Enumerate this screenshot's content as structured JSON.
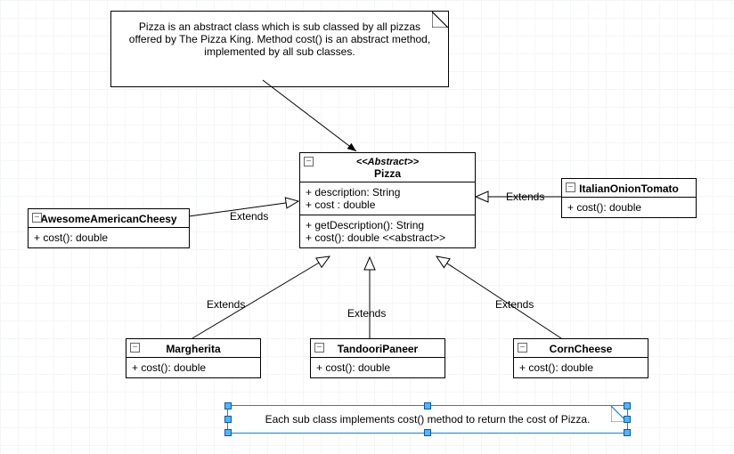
{
  "notes": {
    "top": {
      "text": "Pizza is an abstract class which is sub classed by all pizzas offered by The Pizza King. Method cost() is an abstract method, implemented by all sub classes."
    },
    "bottom": {
      "text": "Each sub class implements cost() method to return the cost of Pizza."
    }
  },
  "classes": {
    "pizza": {
      "stereotype": "<<Abstract>>",
      "name": "Pizza",
      "attrs": [
        "+ description: String",
        "+ cost : double"
      ],
      "ops": [
        "+ getDescription(): String",
        "+ cost(): double <<abstract>>"
      ]
    },
    "awesome": {
      "name": "AwesomeAmericanCheesy",
      "ops": [
        "+ cost(): double"
      ]
    },
    "italian": {
      "name": "ItalianOnionTomato",
      "ops": [
        "+ cost(): double"
      ]
    },
    "margherita": {
      "name": "Margherita",
      "ops": [
        "+ cost(): double"
      ]
    },
    "tandoori": {
      "name": "TandooriPaneer",
      "ops": [
        "+ cost(): double"
      ]
    },
    "corncheese": {
      "name": "CornCheese",
      "ops": [
        "+ cost(): double"
      ]
    }
  },
  "edges": {
    "extends": "Extends"
  },
  "icons": {
    "collapse": "−"
  }
}
